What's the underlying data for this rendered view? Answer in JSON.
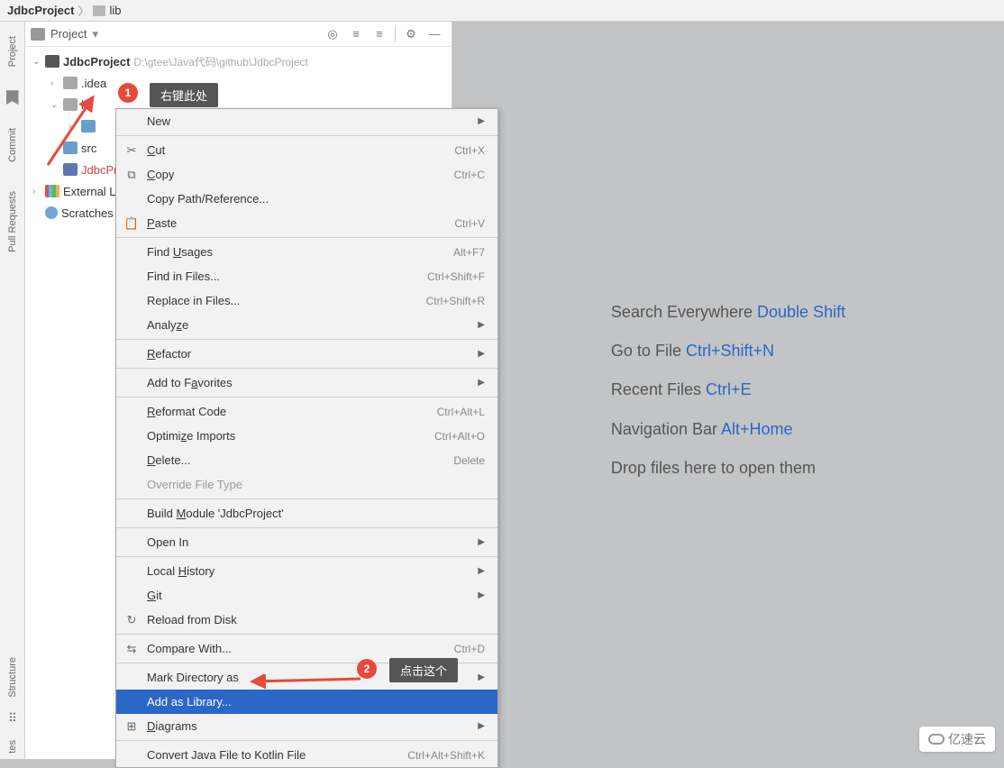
{
  "breadcrumb": {
    "project": "JdbcProject",
    "folder": "lib"
  },
  "panel": {
    "title": "Project",
    "root": "JdbcProject",
    "root_path": "D:\\gtee\\Java代码\\github\\JdbcProject",
    "items": {
      "idea": ".idea",
      "lib": "lib",
      "src": "src",
      "iml": "JdbcProject",
      "external": "External Libraries",
      "scratches": "Scratches and Consoles"
    }
  },
  "callouts": {
    "c1": "右键此处",
    "c2": "点击这个",
    "n1": "1",
    "n2": "2"
  },
  "menu": {
    "new": "New",
    "cut": "Cut",
    "cut_sc": "Ctrl+X",
    "copy": "Copy",
    "copy_sc": "Ctrl+C",
    "copy_path": "Copy Path/Reference...",
    "paste": "Paste",
    "paste_sc": "Ctrl+V",
    "find_usages": "Find Usages",
    "find_usages_sc": "Alt+F7",
    "find_in_files": "Find in Files...",
    "find_in_files_sc": "Ctrl+Shift+F",
    "replace_in_files": "Replace in Files...",
    "replace_in_files_sc": "Ctrl+Shift+R",
    "analyze": "Analyze",
    "refactor": "Refactor",
    "favorites": "Add to Favorites",
    "reformat": "Reformat Code",
    "reformat_sc": "Ctrl+Alt+L",
    "optimize": "Optimize Imports",
    "optimize_sc": "Ctrl+Alt+O",
    "delete": "Delete...",
    "delete_sc": "Delete",
    "override": "Override File Type",
    "build": "Build Module 'JdbcProject'",
    "open_in": "Open In",
    "local_history": "Local History",
    "git": "Git",
    "reload": "Reload from Disk",
    "compare": "Compare With...",
    "compare_sc": "Ctrl+D",
    "mark_dir": "Mark Directory as",
    "add_lib": "Add as Library...",
    "diagrams": "Diagrams",
    "convert": "Convert Java File to Kotlin File",
    "convert_sc": "Ctrl+Alt+Shift+K"
  },
  "hints": {
    "search": "Search Everywhere",
    "search_k": "Double Shift",
    "goto": "Go to File",
    "goto_k": "Ctrl+Shift+N",
    "recent": "Recent Files",
    "recent_k": "Ctrl+E",
    "navbar": "Navigation Bar",
    "navbar_k": "Alt+Home",
    "drop": "Drop files here to open them"
  },
  "rail": {
    "project": "Project",
    "commit": "Commit",
    "pull": "Pull Requests",
    "structure": "Structure",
    "fav": "tes"
  },
  "watermark": "亿速云"
}
